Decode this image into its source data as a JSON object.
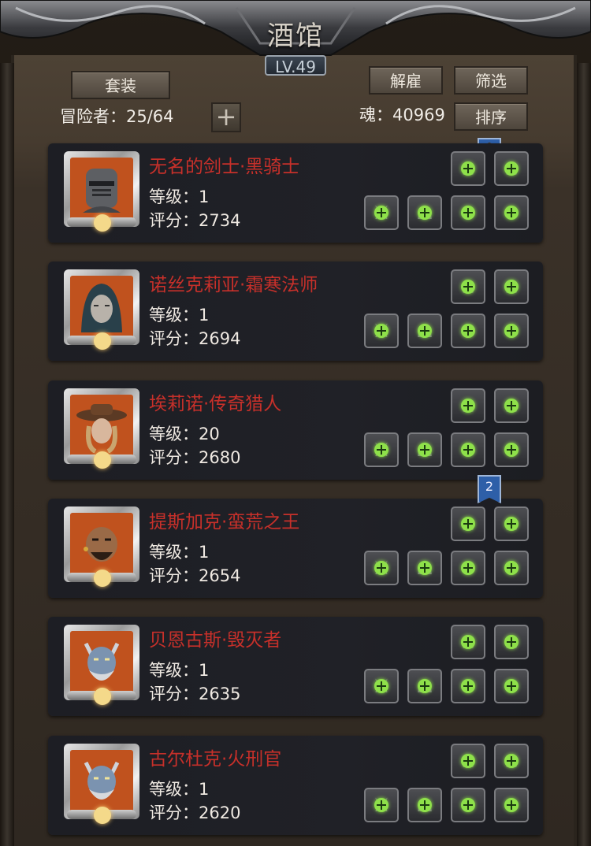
{
  "header": {
    "title": "酒馆",
    "level": "LV.49"
  },
  "toolbar": {
    "outfit_label": "套装",
    "dismiss_label": "解雇",
    "filter_label": "筛选",
    "sort_label": "排序",
    "adventurers_text": "冒险者：25/64",
    "soul_text": "魂：40969"
  },
  "heroes": [
    {
      "name": "无名的剑士·黑骑士",
      "level_text": "等级：1",
      "score_text": "评分：2734",
      "avatar": "helmet-knight"
    },
    {
      "name": "诺丝克莉亚·霜寒法师",
      "level_text": "等级：1",
      "score_text": "评分：2694",
      "avatar": "hooded-mage"
    },
    {
      "name": "埃莉诺·传奇猎人",
      "level_text": "等级：20",
      "score_text": "评分：2680",
      "avatar": "hat-hunter"
    },
    {
      "name": "提斯加克·蛮荒之王",
      "level_text": "等级：1",
      "score_text": "评分：2654",
      "avatar": "barbarian"
    },
    {
      "name": "贝恩古斯·毁灭者",
      "level_text": "等级：1",
      "score_text": "评分：2635",
      "avatar": "demon"
    },
    {
      "name": "古尔杜克·火刑官",
      "level_text": "等级：1",
      "score_text": "评分：2620",
      "avatar": "demon"
    }
  ],
  "bookmark_badge": "2",
  "colors": {
    "hero_name": "#c7302a",
    "plus_green": "#8ee04a",
    "portrait_bg": "#c0521e"
  }
}
